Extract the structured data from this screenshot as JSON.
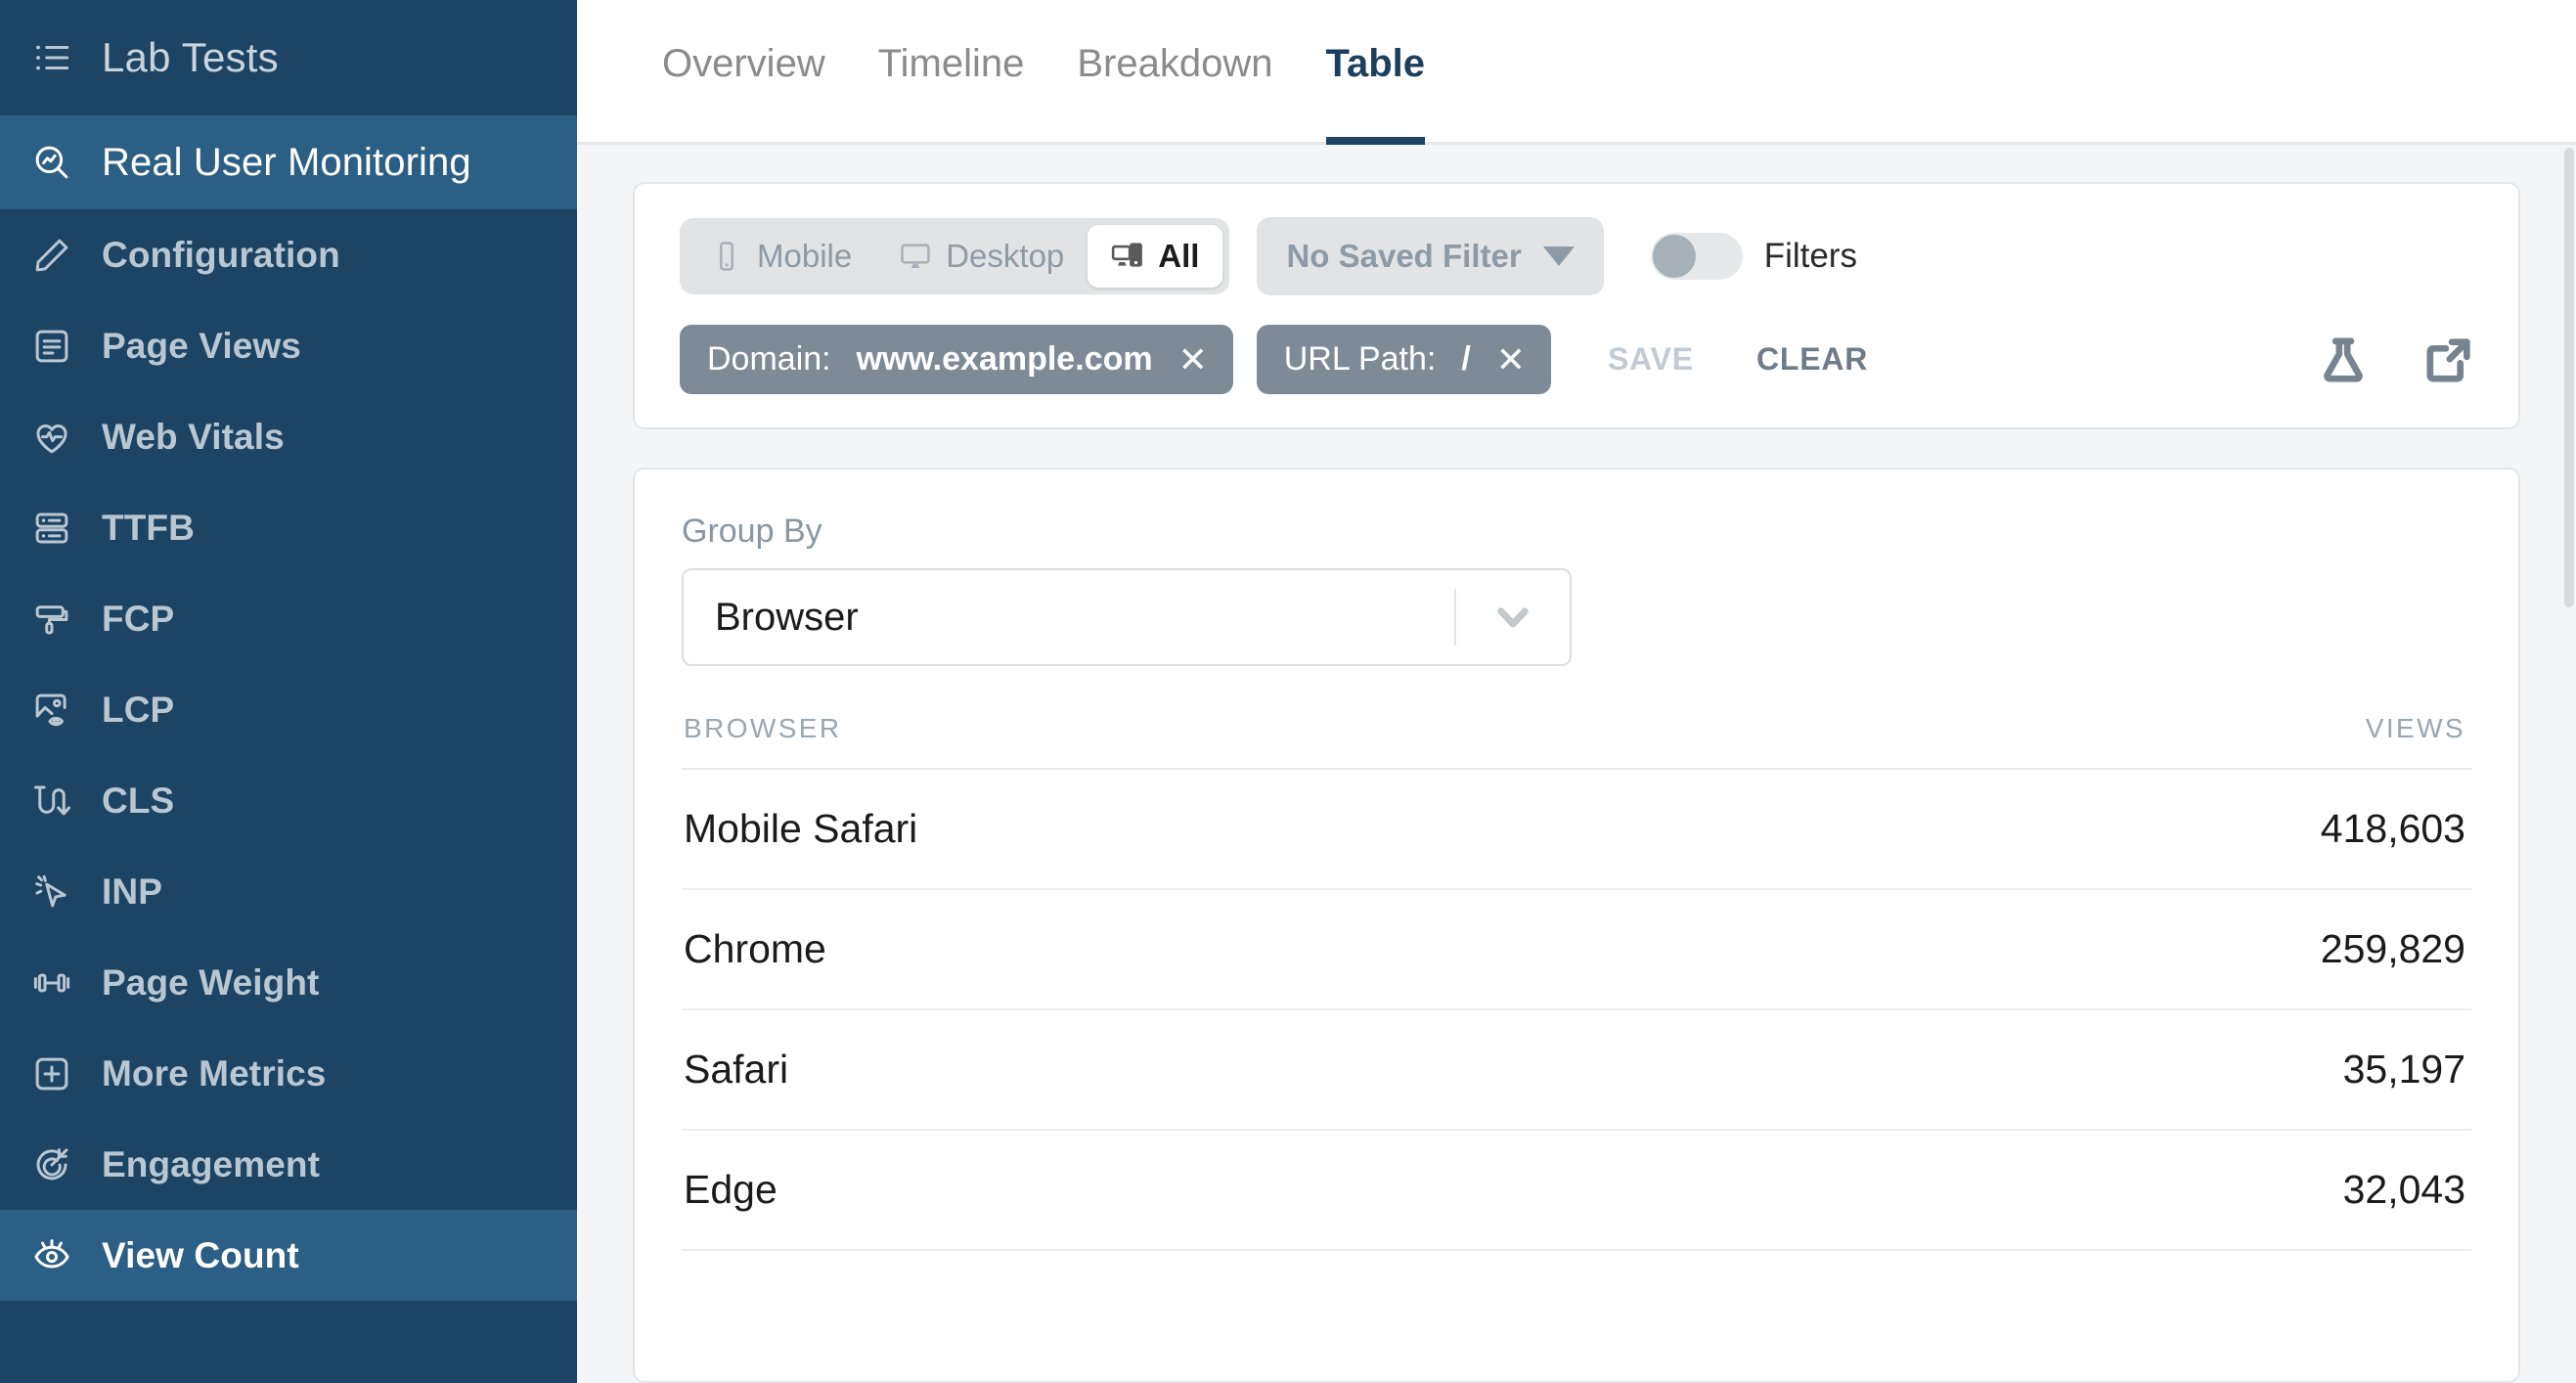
{
  "sidebar": {
    "header": {
      "label": "Lab Tests",
      "icon": "list-icon"
    },
    "items": [
      {
        "label": "Real User Monitoring",
        "icon": "search-chart-icon",
        "active": true,
        "primary": true
      },
      {
        "label": "Configuration",
        "icon": "pencil-icon",
        "active": false,
        "primary": false
      },
      {
        "label": "Page Views",
        "icon": "document-icon",
        "active": false,
        "primary": false
      },
      {
        "label": "Web Vitals",
        "icon": "heart-pulse-icon",
        "active": false,
        "primary": false
      },
      {
        "label": "TTFB",
        "icon": "server-icon",
        "active": false,
        "primary": false
      },
      {
        "label": "FCP",
        "icon": "paint-roller-icon",
        "active": false,
        "primary": false
      },
      {
        "label": "LCP",
        "icon": "image-eye-icon",
        "active": false,
        "primary": false
      },
      {
        "label": "CLS",
        "icon": "shift-arrow-icon",
        "active": false,
        "primary": false
      },
      {
        "label": "INP",
        "icon": "cursor-click-icon",
        "active": false,
        "primary": false
      },
      {
        "label": "Page Weight",
        "icon": "dumbbell-icon",
        "active": false,
        "primary": false
      },
      {
        "label": "More Metrics",
        "icon": "plus-square-icon",
        "active": false,
        "primary": false
      },
      {
        "label": "Engagement",
        "icon": "target-icon",
        "active": false,
        "primary": false
      },
      {
        "label": "View Count",
        "icon": "eye-icon",
        "active": true,
        "primary": false
      }
    ]
  },
  "tabs": [
    {
      "label": "Overview",
      "active": false
    },
    {
      "label": "Timeline",
      "active": false
    },
    {
      "label": "Breakdown",
      "active": false
    },
    {
      "label": "Table",
      "active": true
    }
  ],
  "filters": {
    "device_segments": [
      {
        "label": "Mobile",
        "icon": "phone-icon",
        "active": false
      },
      {
        "label": "Desktop",
        "icon": "monitor-icon",
        "active": false
      },
      {
        "label": "All",
        "icon": "devices-icon",
        "active": true
      }
    ],
    "saved_filter": {
      "label": "No Saved Filter",
      "icon": "caret-down-icon"
    },
    "toggle": {
      "label": "Filters",
      "on": false
    },
    "chips": [
      {
        "key": "Domain:",
        "value": "www.example.com",
        "remove_icon": "close-icon"
      },
      {
        "key": "URL Path:",
        "value": "/",
        "remove_icon": "close-icon"
      }
    ],
    "save_label": "SAVE",
    "clear_label": "CLEAR",
    "actions": [
      {
        "icon": "flask-icon"
      },
      {
        "icon": "external-link-icon"
      }
    ]
  },
  "table_panel": {
    "group_by_label": "Group By",
    "group_by_value": "Browser",
    "columns": [
      "BROWSER",
      "VIEWS"
    ],
    "rows": [
      {
        "name": "Mobile Safari",
        "views": "418,603"
      },
      {
        "name": "Chrome",
        "views": "259,829"
      },
      {
        "name": "Safari",
        "views": "35,197"
      },
      {
        "name": "Edge",
        "views": "32,043"
      }
    ]
  },
  "colors": {
    "sidebar_bg": "#1d4463",
    "sidebar_active": "#2c5f85",
    "tab_active": "#1d3f5e",
    "chip_bg": "#7e8b96",
    "page_bg": "#f4f5f6"
  }
}
